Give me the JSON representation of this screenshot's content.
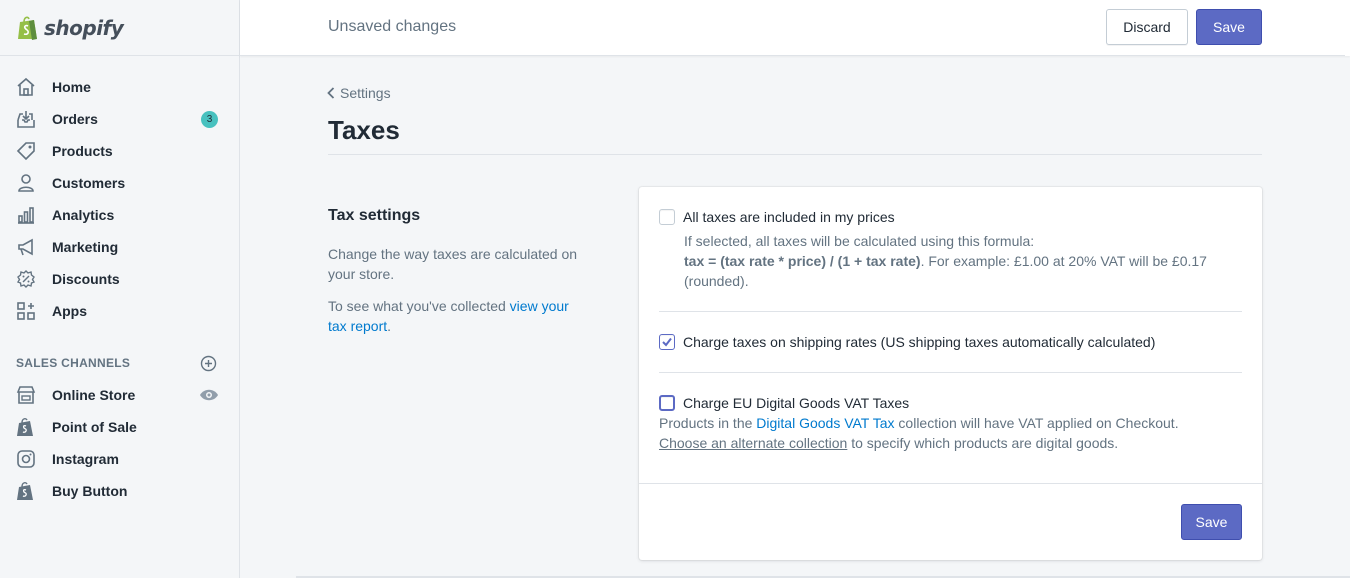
{
  "brand": {
    "name": "shopify",
    "color": "#95bf47"
  },
  "sidebar": {
    "items": [
      {
        "label": "Home",
        "icon": "home-icon"
      },
      {
        "label": "Orders",
        "icon": "orders-icon",
        "badge": "3"
      },
      {
        "label": "Products",
        "icon": "tag-icon"
      },
      {
        "label": "Customers",
        "icon": "person-icon"
      },
      {
        "label": "Analytics",
        "icon": "bar-chart-icon"
      },
      {
        "label": "Marketing",
        "icon": "megaphone-icon"
      },
      {
        "label": "Discounts",
        "icon": "discount-icon"
      },
      {
        "label": "Apps",
        "icon": "apps-icon"
      }
    ],
    "channels_title": "SALES CHANNELS",
    "channels": [
      {
        "label": "Online Store",
        "icon": "store-icon"
      },
      {
        "label": "Point of Sale",
        "icon": "shopify-bag-icon"
      },
      {
        "label": "Instagram",
        "icon": "instagram-icon"
      },
      {
        "label": "Buy Button",
        "icon": "shopify-bag-icon"
      }
    ]
  },
  "topbar": {
    "title": "Unsaved changes",
    "discard_label": "Discard",
    "save_label": "Save"
  },
  "page": {
    "breadcrumb": "Settings",
    "title": "Taxes"
  },
  "tax_settings": {
    "heading": "Tax settings",
    "description": "Change the way taxes are calculated on your store.",
    "report_prefix": "To see what you've collected ",
    "report_link": "view your tax report",
    "report_suffix": "."
  },
  "options": {
    "included": {
      "label": "All taxes are included in my prices",
      "checked": false,
      "help_line1": "If selected, all taxes will be calculated using this formula:",
      "formula": "tax = (tax rate * price) / (1 + tax rate)",
      "example": ". For example: £1.00 at 20% VAT will be £0.17 (rounded)."
    },
    "shipping": {
      "label": "Charge taxes on shipping rates (US shipping taxes automatically calculated)",
      "checked": true
    },
    "eu_vat": {
      "label": "Charge EU Digital Goods VAT Taxes",
      "checked": false,
      "help_prefix": "Products in the ",
      "help_link": "Digital Goods VAT Tax",
      "help_suffix": " collection will have VAT applied on Checkout.",
      "alt_link": "Choose an alternate collection",
      "alt_suffix": " to specify which products are digital goods."
    }
  },
  "card": {
    "save_label": "Save"
  },
  "colors": {
    "accent": "#5c6ac4",
    "badge": "#47c1bf",
    "link": "#007ace"
  }
}
